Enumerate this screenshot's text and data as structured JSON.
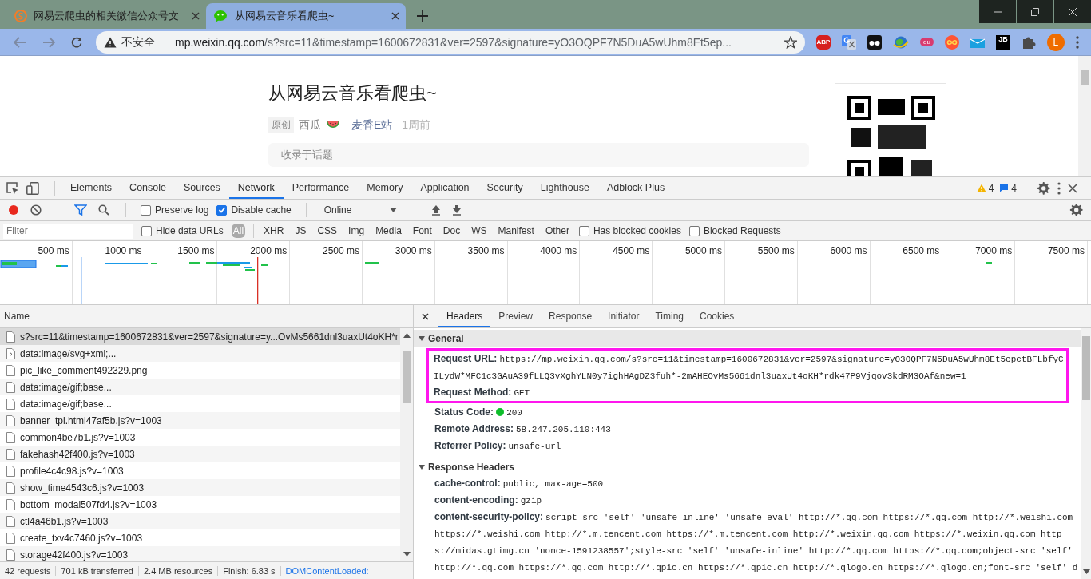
{
  "browser": {
    "tabs": [
      {
        "title": "网易云爬虫的相关微信公众号文",
        "kind": "sogou",
        "selected": false
      },
      {
        "title": "从网易云音乐看爬虫~",
        "kind": "wechat",
        "selected": true
      }
    ],
    "address_bar": {
      "security_label": "不安全",
      "host": "mp.weixin.qq.com",
      "path": "/s?src=11&timestamp=1600672831&ver=2597&signature=yO3OQPF7N5DuA5wUhm8Et5ep..."
    },
    "extensions": [
      {
        "kind": "abp",
        "label": "ABP"
      },
      {
        "kind": "translate"
      },
      {
        "kind": "glasses"
      },
      {
        "kind": "globe"
      },
      {
        "kind": "du",
        "label": "du"
      },
      {
        "kind": "infinity"
      },
      {
        "kind": "box"
      },
      {
        "kind": "jb",
        "label": "JB"
      },
      {
        "kind": "puzzle"
      }
    ],
    "avatar": "L"
  },
  "page": {
    "title": "从网易云音乐看爬虫~",
    "tag": "原创",
    "author": "西瓜",
    "account": "麦香E站",
    "time": "1周前",
    "topic": "收录于话题"
  },
  "devtools": {
    "tabs": [
      {
        "label": "Elements",
        "selected": false
      },
      {
        "label": "Console",
        "selected": false
      },
      {
        "label": "Sources",
        "selected": false
      },
      {
        "label": "Network",
        "selected": true
      },
      {
        "label": "Performance",
        "selected": false
      },
      {
        "label": "Memory",
        "selected": false
      },
      {
        "label": "Application",
        "selected": false
      },
      {
        "label": "Security",
        "selected": false
      },
      {
        "label": "Lighthouse",
        "selected": false
      },
      {
        "label": "Adblock Plus",
        "selected": false
      }
    ],
    "warnings": "4",
    "messages": "4",
    "toolbar": {
      "recording": true,
      "filter_active": true,
      "preserve_log": {
        "label": "Preserve log",
        "checked": false
      },
      "disable_cache": {
        "label": "Disable cache",
        "checked": true
      },
      "throttle": "Online"
    },
    "filter": {
      "placeholder": "Filter",
      "hide_data_urls": {
        "label": "Hide data URLs",
        "checked": false
      },
      "types": [
        {
          "label": "All",
          "selected": true
        },
        {
          "label": "XHR",
          "selected": false
        },
        {
          "label": "JS",
          "selected": false
        },
        {
          "label": "CSS",
          "selected": false
        },
        {
          "label": "Img",
          "selected": false
        },
        {
          "label": "Media",
          "selected": false
        },
        {
          "label": "Font",
          "selected": false
        },
        {
          "label": "Doc",
          "selected": false
        },
        {
          "label": "WS",
          "selected": false
        },
        {
          "label": "Manifest",
          "selected": false
        },
        {
          "label": "Other",
          "selected": false
        }
      ],
      "has_blocked_cookies": {
        "label": "Has blocked cookies",
        "checked": false
      },
      "blocked_requests": {
        "label": "Blocked Requests",
        "checked": false
      }
    },
    "timeline": {
      "ticks": [
        "500 ms",
        "1000 ms",
        "1500 ms",
        "2000 ms",
        "2500 ms",
        "3000 ms",
        "3500 ms",
        "4000 ms",
        "4500 ms",
        "5000 ms",
        "5500 ms",
        "6000 ms",
        "6500 ms",
        "7000 ms",
        "7500 ms"
      ]
    },
    "requests": {
      "column": "Name",
      "rows": [
        {
          "name": "s?src=11&timestamp=1600672831&ver=2597&signature=y...OvMs5661dnl3uaxUt4oKH*r",
          "kind": "file",
          "selected": true
        },
        {
          "name": "data:image/svg+xml;...",
          "kind": "svg",
          "selected": false
        },
        {
          "name": "pic_like_comment492329.png",
          "kind": "file",
          "selected": false
        },
        {
          "name": "data:image/gif;base...",
          "kind": "file",
          "selected": false
        },
        {
          "name": "data:image/gif;base...",
          "kind": "file",
          "selected": false
        },
        {
          "name": "banner_tpl.html47af5b.js?v=1003",
          "kind": "file",
          "selected": false
        },
        {
          "name": "common4be7b1.js?v=1003",
          "kind": "file",
          "selected": false
        },
        {
          "name": "fakehash42f400.js?v=1003",
          "kind": "file",
          "selected": false
        },
        {
          "name": "profile4c4c98.js?v=1003",
          "kind": "file",
          "selected": false
        },
        {
          "name": "show_time4543c6.js?v=1003",
          "kind": "file",
          "selected": false
        },
        {
          "name": "bottom_modal507fd4.js?v=1003",
          "kind": "file",
          "selected": false
        },
        {
          "name": "ctl4a46b1.js?v=1003",
          "kind": "file",
          "selected": false
        },
        {
          "name": "create_txv4c7460.js?v=1003",
          "kind": "file",
          "selected": false
        },
        {
          "name": "storage42f400.js?v=1003",
          "kind": "file",
          "selected": false
        }
      ]
    },
    "status_bar": [
      "42 requests",
      "701 kB transferred",
      "2.4 MB resources",
      "Finish: 6.83 s",
      "DOMContentLoaded:"
    ],
    "detail": {
      "tabs": [
        {
          "label": "Headers",
          "selected": true
        },
        {
          "label": "Preview",
          "selected": false
        },
        {
          "label": "Response",
          "selected": false
        },
        {
          "label": "Initiator",
          "selected": false
        },
        {
          "label": "Timing",
          "selected": false
        },
        {
          "label": "Cookies",
          "selected": false
        }
      ],
      "sections": [
        {
          "title": "General",
          "expanded": true,
          "rows": [
            {
              "key": "Request URL:",
              "value": "https://mp.weixin.qq.com/s?src=11&timestamp=1600672831&ver=2597&signature=yO3OQPF7N5DuA5wUhm8Et5epctBFLbfyCILydW*MFC1c3GAuA39fLLQ3vXghYLN0y7ighHAgDZ3fuh*-2mAHEOvMs5661dnl3uaxUt4oKH*rdk47P9Vjqov3kdRM3OAf&new=1",
              "kind": "text",
              "highlighted": true
            },
            {
              "key": "Request Method:",
              "value": "GET",
              "kind": "text",
              "highlighted": true
            },
            {
              "key": "Status Code:",
              "value": "200",
              "kind": "status",
              "highlighted": false
            },
            {
              "key": "Remote Address:",
              "value": "58.247.205.110:443",
              "kind": "text",
              "highlighted": false
            },
            {
              "key": "Referrer Policy:",
              "value": "unsafe-url",
              "kind": "text",
              "highlighted": false
            }
          ]
        },
        {
          "title": "Response Headers",
          "expanded": true,
          "rows": [
            {
              "key": "cache-control:",
              "value": "public, max-age=500",
              "kind": "text",
              "highlighted": false
            },
            {
              "key": "content-encoding:",
              "value": "gzip",
              "kind": "text",
              "highlighted": false
            },
            {
              "key": "content-security-policy:",
              "value": "script-src 'self' 'unsafe-inline' 'unsafe-eval' http://*.qq.com https://*.qq.com http://*.weishi.com https://*.weishi.com http://*.m.tencent.com https://*.m.tencent.com http://*.weixin.qq.com https://*.weixin.qq.com https://midas.gtimg.cn 'nonce-1591238557';style-src 'self' 'unsafe-inline' http://*.qq.com https://*.qq.com;object-src 'self' http://*.qq.com https://*.qq.com http://*.qpic.cn https://*.qpic.cn http://*.qlogo.cn https://*.qlogo.cn;font-src 'self' d",
              "kind": "text",
              "highlighted": false
            }
          ]
        }
      ]
    }
  }
}
